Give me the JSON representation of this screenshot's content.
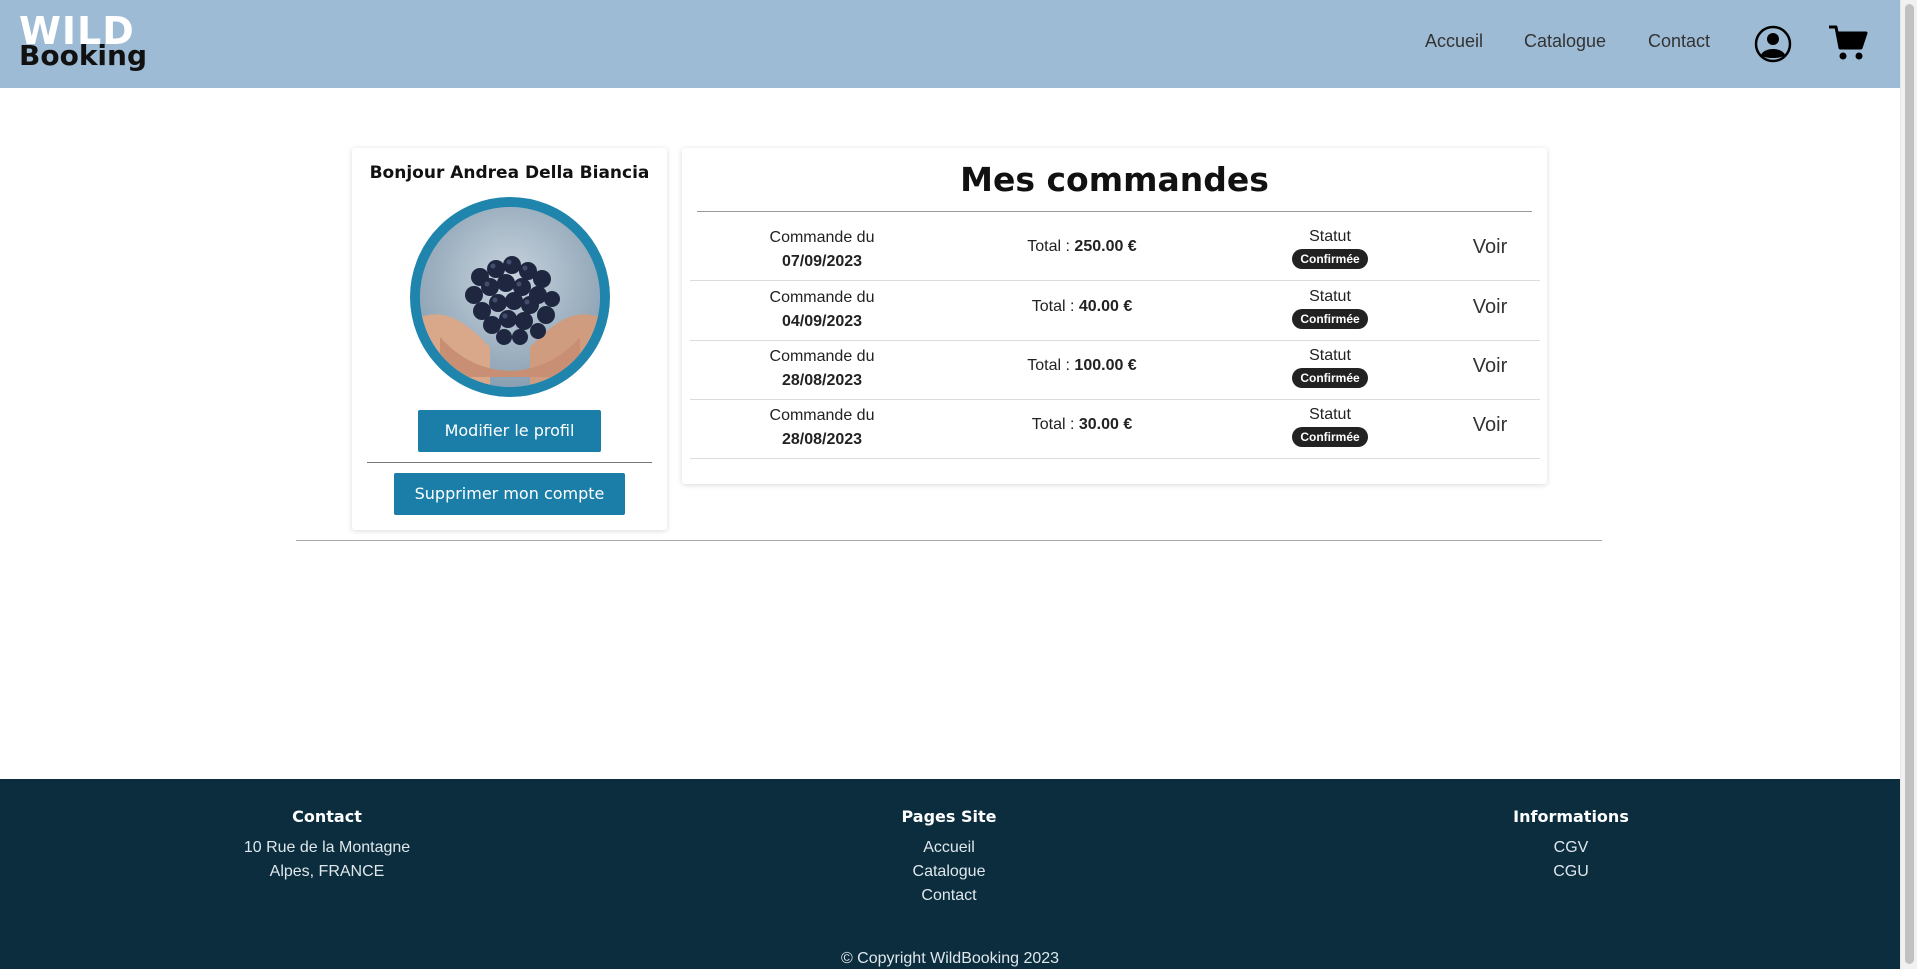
{
  "header": {
    "logo_top": "WILD",
    "logo_bottom": "Booking",
    "nav": [
      "Accueil",
      "Catalogue",
      "Contact"
    ],
    "icons": [
      "user-icon",
      "cart-icon"
    ]
  },
  "profile": {
    "greeting": "Bonjour Andrea Della Biancia",
    "avatar": "grapes-in-hands-photo",
    "modify_label": "Modifier le profil",
    "delete_label": "Supprimer mon compte"
  },
  "orders": {
    "title": "Mes commandes",
    "list": [
      {
        "label": "Commande du",
        "date": "07/09/2023",
        "total_label": "Total :",
        "total": "250.00 €",
        "status_label": "Statut",
        "status": "Confirmée",
        "action": "Voir"
      },
      {
        "label": "Commande du",
        "date": "04/09/2023",
        "total_label": "Total :",
        "total": "40.00 €",
        "status_label": "Statut",
        "status": "Confirmée",
        "action": "Voir"
      },
      {
        "label": "Commande du",
        "date": "28/08/2023",
        "total_label": "Total :",
        "total": "100.00 €",
        "status_label": "Statut",
        "status": "Confirmée",
        "action": "Voir"
      },
      {
        "label": "Commande du",
        "date": "28/08/2023",
        "total_label": "Total :",
        "total": "30.00 €",
        "status_label": "Statut",
        "status": "Confirmée",
        "action": "Voir"
      }
    ]
  },
  "footer": {
    "contact": {
      "title": "Contact",
      "line1": "10 Rue de la Montagne",
      "line2": "Alpes, FRANCE"
    },
    "pages": {
      "title": "Pages Site",
      "links": [
        "Accueil",
        "Catalogue",
        "Contact"
      ]
    },
    "info": {
      "title": "Informations",
      "links": [
        "CGV",
        "CGU"
      ]
    },
    "copyright": "© Copyright WildBooking 2023"
  },
  "colors": {
    "header_bg": "#9dbbd5",
    "accent": "#1a7ea8",
    "footer_bg": "#0b2d3d"
  }
}
